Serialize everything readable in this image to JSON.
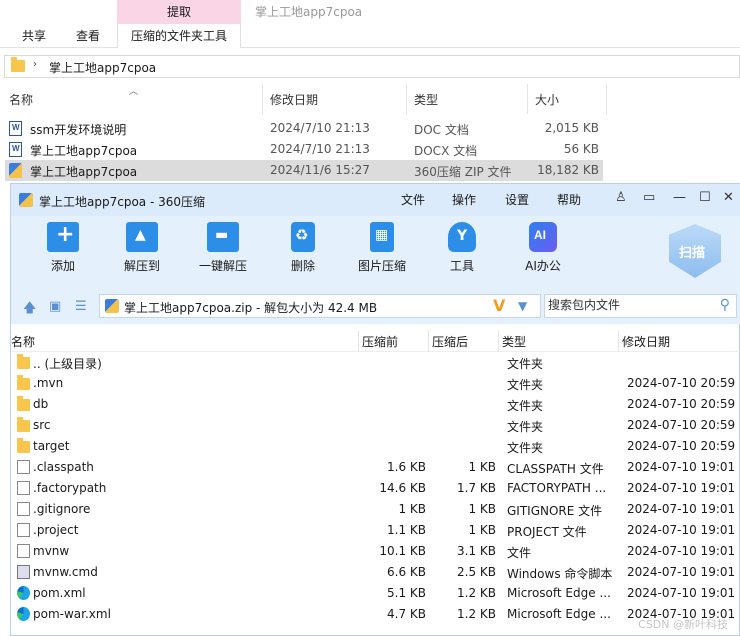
{
  "ribbon": {
    "context_group": "提取",
    "context_title": "掌上工地app7cpoa",
    "tabs": [
      "共享",
      "查看",
      "压缩的文件夹工具"
    ]
  },
  "address": {
    "path": "掌上工地app7cpoa"
  },
  "explorer": {
    "columns": [
      "名称",
      "修改日期",
      "类型",
      "大小"
    ],
    "rows": [
      {
        "name": "ssm开发环境说明",
        "date": "2024/7/10 21:13",
        "type": "DOC 文档",
        "size": "2,015 KB",
        "icon": "word-doc-icon"
      },
      {
        "name": "掌上工地app7cpoa",
        "date": "2024/7/10 21:13",
        "type": "DOCX 文档",
        "size": "56 KB",
        "icon": "word-doc-icon"
      },
      {
        "name": "掌上工地app7cpoa",
        "date": "2024/11/6 15:27",
        "type": "360压缩 ZIP 文件",
        "size": "18,182 KB",
        "icon": "zip-icon"
      }
    ]
  },
  "zipwin": {
    "title": "掌上工地app7cpoa - 360压缩",
    "menu": [
      "文件",
      "操作",
      "设置",
      "帮助"
    ],
    "tools": [
      "添加",
      "解压到",
      "一键解压",
      "删除",
      "图片压缩",
      "工具",
      "AI办公"
    ],
    "scan_label": "扫描",
    "path_text": "掌上工地app7cpoa.zip - 解包大小为 42.4 MB",
    "search_placeholder": "搜索包内文件",
    "columns": [
      "名称",
      "压缩前",
      "压缩后",
      "类型",
      "修改日期"
    ],
    "rows": [
      {
        "name": ".. (上级目录)",
        "before": "",
        "after": "",
        "type": "文件夹",
        "date": "",
        "kind": "folder"
      },
      {
        "name": ".mvn",
        "before": "",
        "after": "",
        "type": "文件夹",
        "date": "2024-07-10 20:59",
        "kind": "folder"
      },
      {
        "name": "db",
        "before": "",
        "after": "",
        "type": "文件夹",
        "date": "2024-07-10 20:59",
        "kind": "folder"
      },
      {
        "name": "src",
        "before": "",
        "after": "",
        "type": "文件夹",
        "date": "2024-07-10 20:59",
        "kind": "folder"
      },
      {
        "name": "target",
        "before": "",
        "after": "",
        "type": "文件夹",
        "date": "2024-07-10 20:59",
        "kind": "folder"
      },
      {
        "name": ".classpath",
        "before": "1.6 KB",
        "after": "1 KB",
        "type": "CLASSPATH 文件",
        "date": "2024-07-10 19:01",
        "kind": "file"
      },
      {
        "name": ".factorypath",
        "before": "14.6 KB",
        "after": "1.7 KB",
        "type": "FACTORYPATH ...",
        "date": "2024-07-10 19:01",
        "kind": "file"
      },
      {
        "name": ".gitignore",
        "before": "1 KB",
        "after": "1 KB",
        "type": "GITIGNORE 文件",
        "date": "2024-07-10 19:01",
        "kind": "file"
      },
      {
        "name": ".project",
        "before": "1.1 KB",
        "after": "1 KB",
        "type": "PROJECT 文件",
        "date": "2024-07-10 19:01",
        "kind": "file"
      },
      {
        "name": "mvnw",
        "before": "10.1 KB",
        "after": "3.1 KB",
        "type": "文件",
        "date": "2024-07-10 19:01",
        "kind": "file"
      },
      {
        "name": "mvnw.cmd",
        "before": "6.6 KB",
        "after": "2.5 KB",
        "type": "Windows 命令脚本",
        "date": "2024-07-10 19:01",
        "kind": "cmd"
      },
      {
        "name": "pom.xml",
        "before": "5.1 KB",
        "after": "1.2 KB",
        "type": "Microsoft Edge ...",
        "date": "2024-07-10 19:01",
        "kind": "edge"
      },
      {
        "name": "pom-war.xml",
        "before": "4.7 KB",
        "after": "1.2 KB",
        "type": "Microsoft Edge ...",
        "date": "2024-07-10 19:01",
        "kind": "edge"
      }
    ]
  },
  "watermark": "CSDN @新叶科技"
}
